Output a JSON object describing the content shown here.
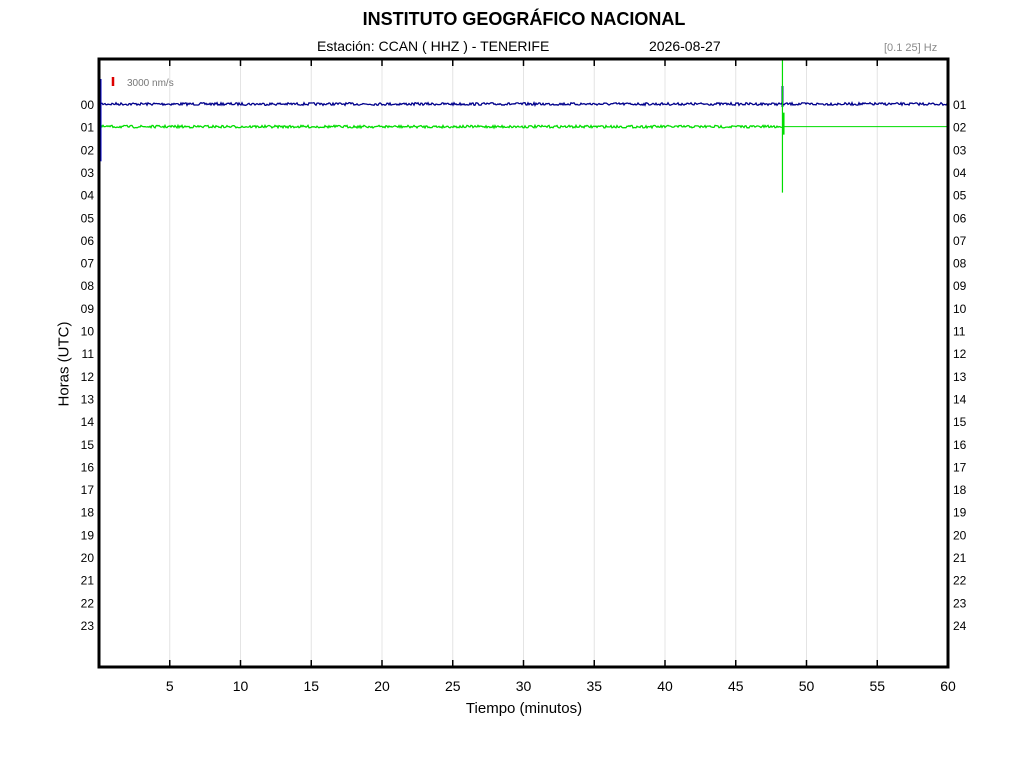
{
  "header": {
    "title": "INSTITUTO GEOGRÁFICO NACIONAL",
    "station": "Estación:  CCAN ( HHZ ) - TENERIFE",
    "date": "2026-08-27",
    "band": "[0.1 25] Hz"
  },
  "chart_data": {
    "type": "line",
    "title": "INSTITUTO GEOGRÁFICO NACIONAL",
    "xlabel": "Tiempo (minutos)",
    "ylabel": "Horas (UTC)",
    "xlim": [
      0,
      60
    ],
    "x_ticks": [
      5,
      10,
      15,
      20,
      25,
      30,
      35,
      40,
      45,
      50,
      55,
      60
    ],
    "y_ticks_left": [
      "00",
      "01",
      "02",
      "03",
      "04",
      "05",
      "06",
      "07",
      "08",
      "09",
      "10",
      "11",
      "12",
      "13",
      "14",
      "15",
      "16",
      "17",
      "18",
      "19",
      "20",
      "21",
      "22",
      "23"
    ],
    "y_ticks_right": [
      "01",
      "02",
      "03",
      "04",
      "05",
      "06",
      "07",
      "08",
      "09",
      "10",
      "11",
      "12",
      "13",
      "14",
      "15",
      "16",
      "17",
      "18",
      "19",
      "20",
      "21",
      "22",
      "23",
      "24"
    ],
    "grid": "vertical",
    "scale_bar": {
      "label": "3000 nm/s",
      "color": "#dd0000"
    },
    "series": [
      {
        "hour": "00",
        "color": "#00008b",
        "start_min": 0,
        "end_min": 60,
        "noise": "low",
        "event_minute": 48.3,
        "event": "small"
      },
      {
        "hour": "01",
        "color": "#00dd00",
        "start_min": 0,
        "end_min": 48.3,
        "noise": "low",
        "event_minute": 48.3,
        "event": "large",
        "flat_after_event": true
      }
    ]
  }
}
